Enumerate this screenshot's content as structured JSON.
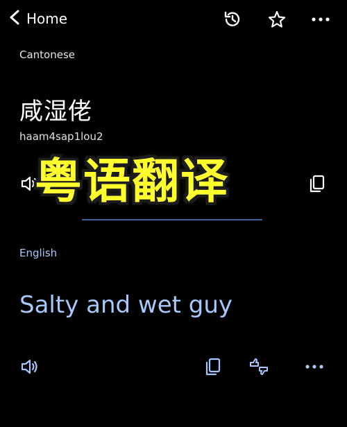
{
  "header": {
    "back_label": "Home",
    "icons": [
      "chevron-left-icon",
      "history-icon",
      "star-icon",
      "more-icon"
    ]
  },
  "source": {
    "language": "Cantonese",
    "text": "咸湿佬",
    "romanization": "haam4sap1lou2",
    "icons": [
      "speaker-icon",
      "copy-icon"
    ]
  },
  "overlay": {
    "caption": "粤语翻译",
    "color": "#ffff2e"
  },
  "target": {
    "language": "English",
    "text": "Salty and wet guy",
    "color": "#a8c7fa",
    "icons": [
      "speaker-icon",
      "copy-icon",
      "feedback-icon",
      "more-icon"
    ]
  }
}
